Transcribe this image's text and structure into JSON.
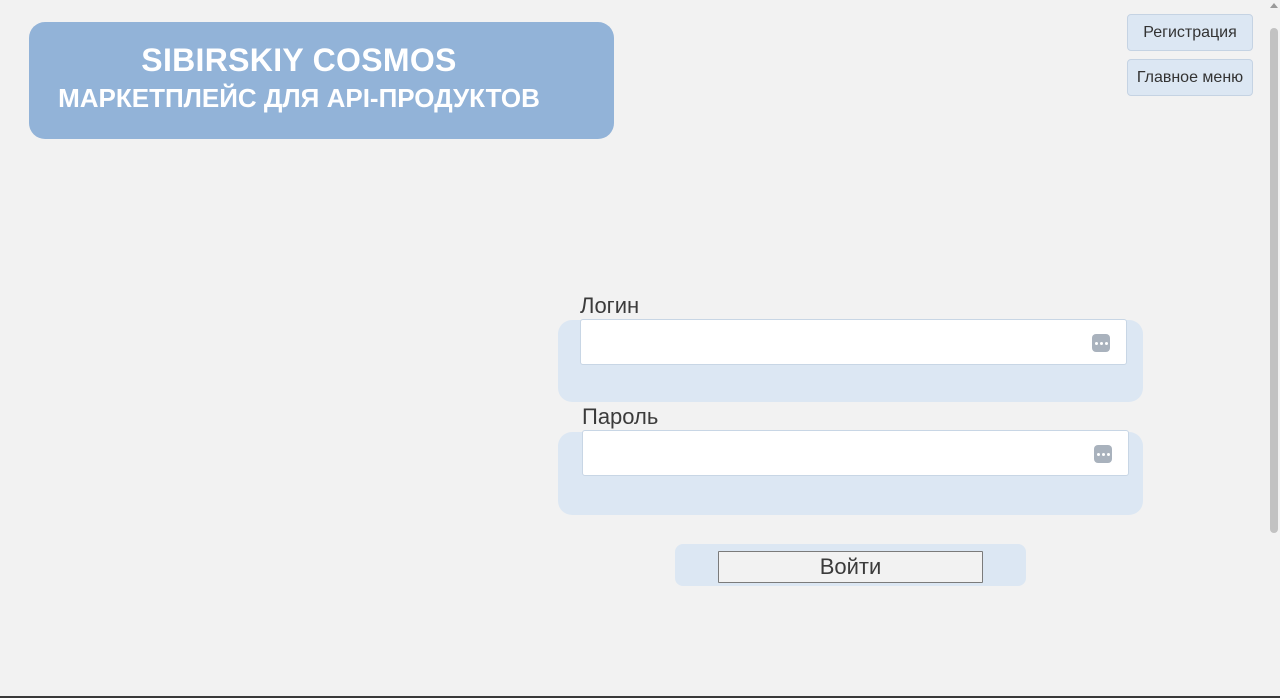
{
  "header": {
    "brand_title": "SIBIRSKIY COSMOS",
    "brand_subtitle": "МАРКЕТПЛЕЙС ДЛЯ API-ПРОДУКТОВ"
  },
  "nav": {
    "register_label": "Регистрация",
    "main_menu_label": "Главное меню"
  },
  "form": {
    "login_label": "Логин",
    "login_value": "",
    "password_label": "Пароль",
    "password_value": "",
    "submit_label": "Войти",
    "autofill_icon": "password-autofill-icon"
  },
  "colors": {
    "background": "#f2f2f2",
    "banner": "#92b3d8",
    "panel": "#dce7f3",
    "text": "#3b3b3b"
  }
}
